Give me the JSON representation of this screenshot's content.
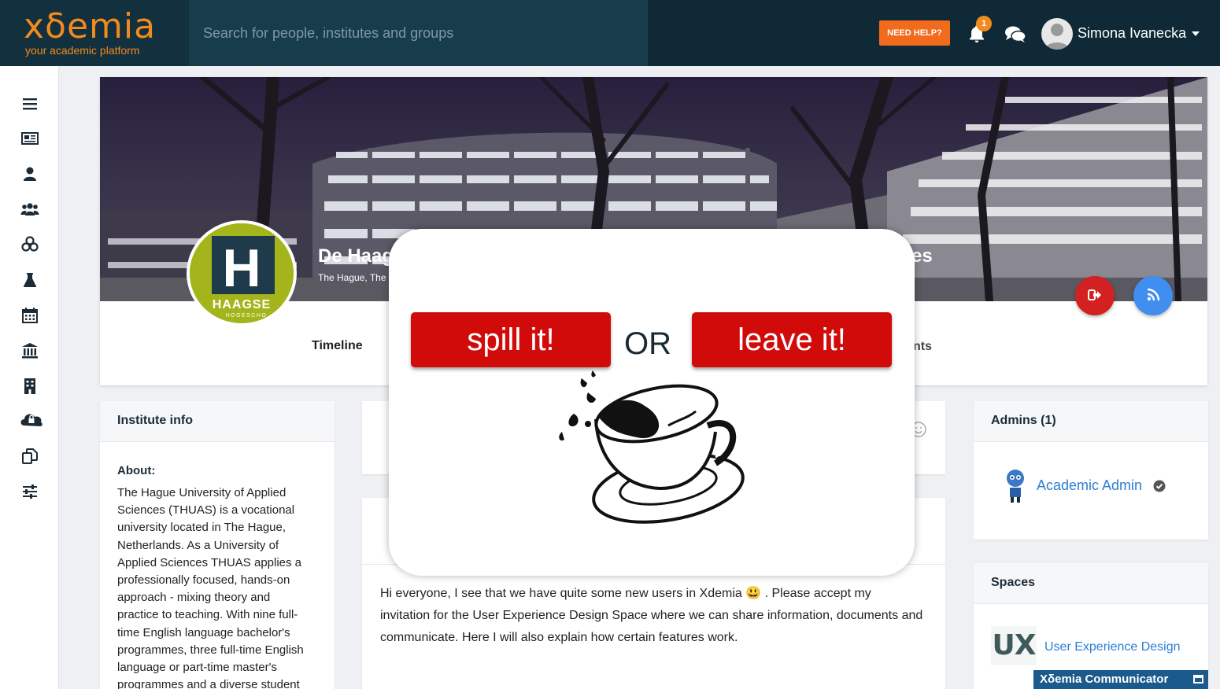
{
  "brand": {
    "logo_text": "xδemia",
    "tagline": "your academic platform",
    "accent": "#f28a1e"
  },
  "header": {
    "search_placeholder": "Search for people, institutes and groups",
    "help_label": "NEED HELP?",
    "notification_count": "1",
    "user_name": "Simona Ivanecka"
  },
  "sidebar": {
    "icons": [
      "menu-icon",
      "newspaper-icon",
      "user-icon",
      "users-icon",
      "groups-icon",
      "flask-icon",
      "calendar-icon",
      "institution-icon",
      "building-icon",
      "cloud-lock-icon",
      "copy-icon",
      "sliders-icon"
    ]
  },
  "institute": {
    "name": "De Haag",
    "name_end": "es",
    "location": "The Hague, The",
    "logo_letter": "H",
    "logo_word": "HAAGSE",
    "logo_sub": "HOGESCHO",
    "tab_timeline": "Timeline",
    "tab_end": "nts"
  },
  "institute_info": {
    "heading": "Institute info",
    "about_label": "About:",
    "about_text": "The Hague University of Applied Sciences (THUAS) is a vocational university located in The Hague, Netherlands. As a University of Applied Sciences THUAS applies a professionally focused, hands-on approach - mixing theory and practice to teaching. With nine full-time English language bachelor's programmes, three full-time English language or part-time master's programmes and a diverse student"
  },
  "post": {
    "text": "Hi everyone, I see that we have quite some new users in Xdemia 😃 . Please accept my invitation for the User Experience Design Space where we can share information, documents and communicate. Here I will also explain how certain features work."
  },
  "admins": {
    "heading": "Admins (1)",
    "name": "Academic Admin"
  },
  "spaces": {
    "heading": "Spaces",
    "logo_text": "UX",
    "name": "User Experience Design"
  },
  "communicator": {
    "label": "Xδemia Communicator"
  },
  "overlay": {
    "spill_label": "spill it!",
    "or_label": "OR",
    "leave_label": "leave it!"
  }
}
